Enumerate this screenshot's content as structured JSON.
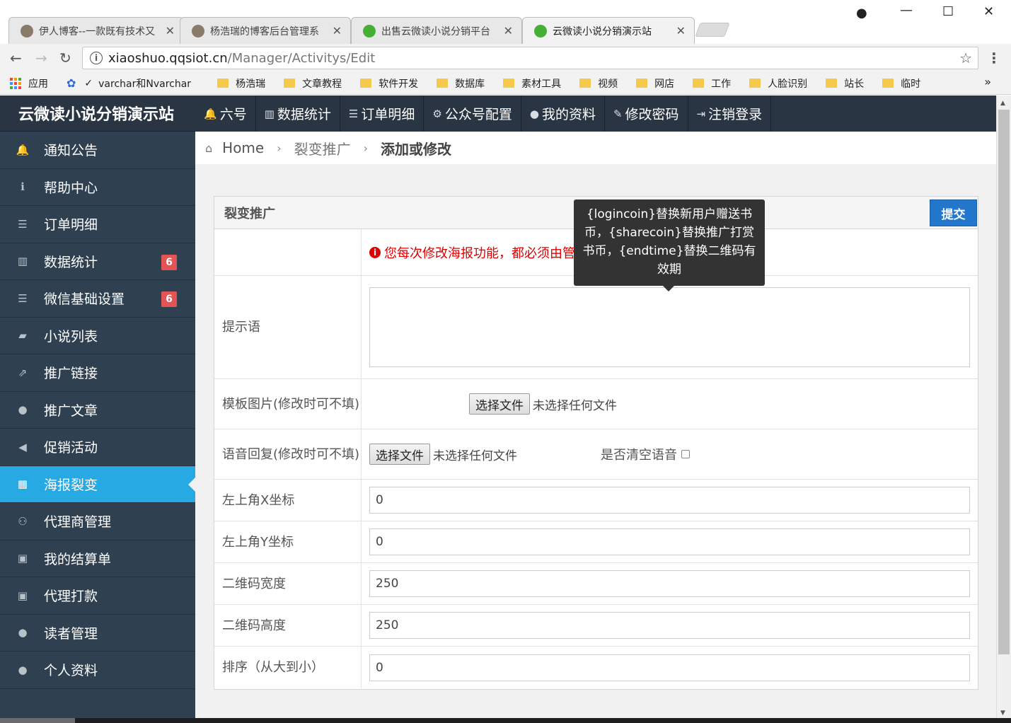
{
  "browser": {
    "tabs": [
      {
        "title": "伊人博客--一款既有技术又",
        "favicon_color": "#8a7a6a"
      },
      {
        "title": "杨浩瑞的博客后台管理系",
        "favicon_color": "#8a7a6a"
      },
      {
        "title": "出售云微读小说分销平台",
        "favicon_color": "#45b035"
      },
      {
        "title": "云微读小说分销演示站",
        "favicon_color": "#45b035"
      }
    ],
    "url_host": "xiaoshuo.qqsiot.cn",
    "url_path": "/Manager/Activitys/Edit",
    "bookmarks": [
      "应用",
      "varchar和Nvarchar",
      "杨浩瑞",
      "文章教程",
      "软件开发",
      "数据库",
      "素材工具",
      "视频",
      "网店",
      "工作",
      "人脸识别",
      "站长",
      "临时"
    ]
  },
  "sidebar": {
    "brand": "云微读小说分销演示站",
    "items": [
      {
        "label": "通知公告",
        "icon": "bell-icon",
        "glyph": "🔔"
      },
      {
        "label": "帮助中心",
        "icon": "info-icon",
        "glyph": "ℹ"
      },
      {
        "label": "订单明细",
        "icon": "list-icon",
        "glyph": "☰"
      },
      {
        "label": "数据统计",
        "icon": "bar-chart-icon",
        "glyph": "▥",
        "badge": "6"
      },
      {
        "label": "微信基础设置",
        "icon": "list-icon",
        "glyph": "☰",
        "badge": "6"
      },
      {
        "label": "小说列表",
        "icon": "book-icon",
        "glyph": "▰"
      },
      {
        "label": "推广链接",
        "icon": "share-icon",
        "glyph": "⇗"
      },
      {
        "label": "推广文章",
        "icon": "comment-icon",
        "glyph": "●"
      },
      {
        "label": "促销活动",
        "icon": "bullhorn-icon",
        "glyph": "◀"
      },
      {
        "label": "海报裂变",
        "icon": "table-icon",
        "glyph": "▦",
        "active": true
      },
      {
        "label": "代理商管理",
        "icon": "sitemap-icon",
        "glyph": "⚇"
      },
      {
        "label": "我的结算单",
        "icon": "money-icon",
        "glyph": "▣"
      },
      {
        "label": "代理打款",
        "icon": "money-icon",
        "glyph": "▣"
      },
      {
        "label": "读者管理",
        "icon": "user-icon",
        "glyph": "●"
      },
      {
        "label": "个人资料",
        "icon": "user-icon",
        "glyph": "●"
      }
    ]
  },
  "topnav": [
    {
      "label": "六号",
      "icon": "bell-icon",
      "glyph": "🔔"
    },
    {
      "label": "数据统计",
      "icon": "bar-chart-icon",
      "glyph": "▥"
    },
    {
      "label": "订单明细",
      "icon": "list-icon",
      "glyph": "☰"
    },
    {
      "label": "公众号配置",
      "icon": "gear-icon",
      "glyph": "⚙"
    },
    {
      "label": "我的资料",
      "icon": "user-icon",
      "glyph": "●"
    },
    {
      "label": "修改密码",
      "icon": "edit-icon",
      "glyph": "✎"
    },
    {
      "label": "注销登录",
      "icon": "sign-out-icon",
      "glyph": "⇥"
    }
  ],
  "breadcrumb": {
    "home": "Home",
    "parent": "裂变推广",
    "current": "添加或修改"
  },
  "panel": {
    "title": "裂变推广",
    "submit": "提交",
    "warning": "您每次修改海报功能，都必须由管理员审核通过，请谨慎修改！！",
    "tooltip": "{logincoin}替换新用户赠送书币，{sharecoin}替换推广打赏书币，{endtime}替换二维码有效期",
    "fields": {
      "prompt_label": "提示语",
      "template_label": "模板图片(修改时可不填)",
      "voice_label": "语音回复(修改时可不填)",
      "choose_file": "选择文件",
      "no_file": "未选择任何文件",
      "clear_voice": "是否清空语音",
      "x_label": "左上角X坐标",
      "x_value": "0",
      "y_label": "左上角Y坐标",
      "y_value": "0",
      "qr_width_label": "二维码宽度",
      "qr_width_value": "250",
      "qr_height_label": "二维码高度",
      "qr_height_value": "250",
      "sort_label": "排序（从大到小）",
      "sort_value": "0"
    }
  }
}
